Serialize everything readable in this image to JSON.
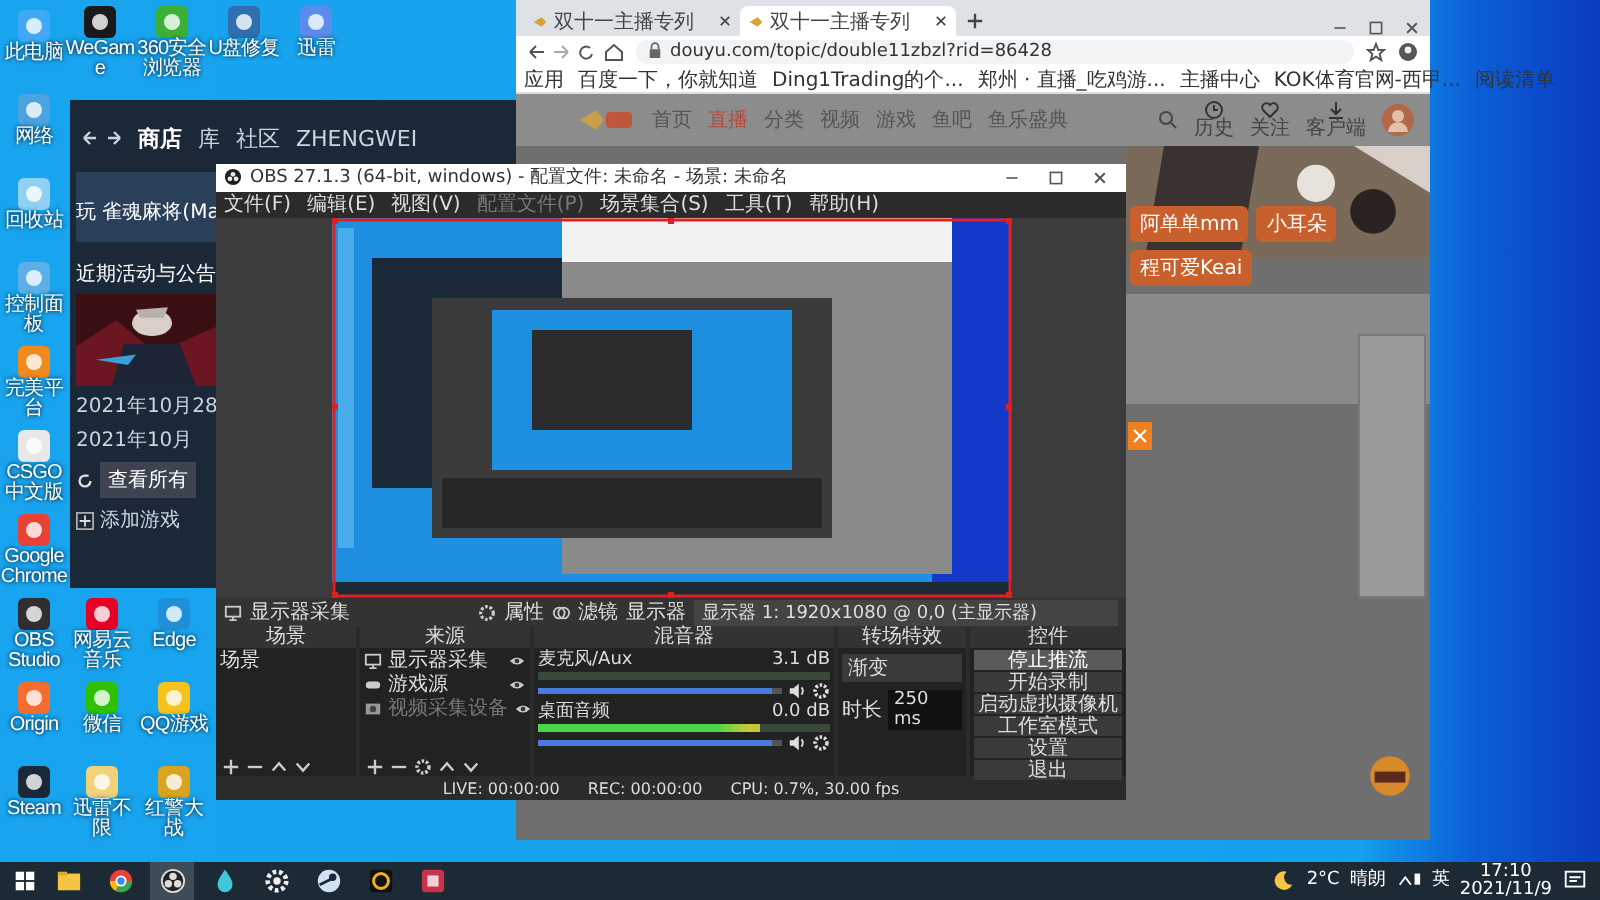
{
  "desktop": {
    "left_column": [
      {
        "label": "此电脑",
        "color": "#3fa9f5"
      },
      {
        "label": "网络",
        "color": "#4aa3df"
      },
      {
        "label": "回收站",
        "color": "#8fd0f4"
      },
      {
        "label": "控制面板",
        "color": "#5bb0e8"
      },
      {
        "label": "完美平台",
        "color": "#f08a1c"
      },
      {
        "label": "CSGO中文版",
        "color": "#e8e8e8"
      },
      {
        "label": "Google Chrome",
        "color": "#e94235"
      },
      {
        "label": "OBS Studio",
        "color": "#302e31"
      },
      {
        "label": "Origin",
        "color": "#f56c2d"
      },
      {
        "label": "Steam",
        "color": "#1b2838"
      }
    ],
    "top_row": [
      {
        "label": "WeGame",
        "color": "#1a1a1a"
      },
      {
        "label": "360安全浏览器",
        "color": "#3cb034"
      },
      {
        "label": "U盘修复",
        "color": "#2f6fb0"
      },
      {
        "label": "迅雷",
        "color": "#5a8cf0"
      }
    ],
    "grid": [
      {
        "label": "网易云音乐",
        "color": "#e60026"
      },
      {
        "label": "Edge",
        "color": "#1f8fd8"
      },
      {
        "label": "微信",
        "color": "#2dc100"
      },
      {
        "label": "QQ游戏",
        "color": "#f7c21b"
      },
      {
        "label": "迅雷不限",
        "color": "#f0d27a"
      },
      {
        "label": "红警大战",
        "color": "#d9a520"
      }
    ]
  },
  "steam": {
    "nav": [
      {
        "label": "商店",
        "selected": true
      },
      {
        "label": "库",
        "selected": false
      },
      {
        "label": "社区",
        "selected": false
      },
      {
        "label": "ZHENGWEI",
        "selected": false
      }
    ],
    "game_title": "玩 雀魂麻将(Ma",
    "section_title": "近期活动与公告",
    "event_date": "2021年10月28",
    "event_time": "2021年10月",
    "update_button": "查看所有",
    "add_game": "添加游戏"
  },
  "browser": {
    "tabs": [
      {
        "title": "双十一主播专列",
        "selected": false
      },
      {
        "title": "双十一主播专列",
        "selected": true
      }
    ],
    "url": "douyu.com/topic/double11zbzl?rid=86428",
    "bookmarks": [
      "应用",
      "百度一下，你就知道",
      "Ding1Trading的个...",
      "郑州 · 直播_吃鸡游...",
      "主播中心",
      "KOK体育官网-西甲..."
    ],
    "reading_list": "阅读清单",
    "page": {
      "nav": [
        {
          "label": "首页",
          "selected": false
        },
        {
          "label": "直播",
          "selected": true
        },
        {
          "label": "分类",
          "selected": false
        },
        {
          "label": "视频",
          "selected": false
        },
        {
          "label": "游戏",
          "selected": false
        },
        {
          "label": "鱼吧",
          "selected": false
        },
        {
          "label": "鱼乐盛典",
          "selected": false
        }
      ],
      "header_icons": [
        {
          "label": "历史",
          "kind": "clock"
        },
        {
          "label": "关注",
          "kind": "heart"
        },
        {
          "label": "客户端",
          "kind": "download"
        }
      ],
      "cards": [
        "阿单单mm",
        "小耳朵",
        "程可爱Keai"
      ]
    }
  },
  "obs": {
    "title": "OBS 27.1.3 (64-bit, windows) - 配置文件: 未命名 - 场景: 未命名",
    "menu": [
      {
        "label": "文件(F)",
        "disabled": false
      },
      {
        "label": "编辑(E)",
        "disabled": false
      },
      {
        "label": "视图(V)",
        "disabled": false
      },
      {
        "label": "配置文件(P)",
        "disabled": true
      },
      {
        "label": "场景集合(S)",
        "disabled": false
      },
      {
        "label": "工具(T)",
        "disabled": false
      },
      {
        "label": "帮助(H)",
        "disabled": false
      }
    ],
    "source_bar": {
      "source": "显示器采集",
      "properties": "属性",
      "filters": "滤镜",
      "display_label": "显示器",
      "display_value": "显示器 1: 1920x1080 @ 0,0 (主显示器)"
    },
    "docks": {
      "scenes": "场景",
      "sources": "来源",
      "mixer": "混音器",
      "transitions": "转场特效",
      "controls": "控件"
    },
    "scenes": [
      "场景"
    ],
    "sources": [
      {
        "name": "显示器采集",
        "kind": "monitor",
        "disabled": false
      },
      {
        "name": "游戏源",
        "kind": "game",
        "disabled": false
      },
      {
        "name": "视频采集设备",
        "kind": "camera",
        "disabled": true
      }
    ],
    "mixer": [
      {
        "name": "麦克风/Aux",
        "reading": "3.1 dB",
        "volume": {
          "level": 0.96
        }
      },
      {
        "name": "桌面音频",
        "reading": "0.0 dB",
        "meter": {
          "level": 0.76
        },
        "volume": {
          "level": 0.96
        }
      }
    ],
    "transition": {
      "value": "渐变",
      "duration_label": "时长",
      "duration": "250 ms"
    },
    "controls": [
      {
        "label": "停止推流",
        "selected": true
      },
      {
        "label": "开始录制",
        "selected": false
      },
      {
        "label": "启动虚拟摄像机",
        "selected": false
      },
      {
        "label": "工作室模式",
        "selected": false
      },
      {
        "label": "设置",
        "selected": false
      },
      {
        "label": "退出",
        "selected": false
      }
    ],
    "status": {
      "live": "LIVE: 00:00:00",
      "rec": "REC: 00:00:00",
      "cpu": "CPU: 0.7%, 30.00 fps"
    }
  },
  "taskbar": {
    "apps": [
      {
        "kind": "explorer",
        "selected": false
      },
      {
        "kind": "chrome",
        "selected": false
      },
      {
        "kind": "obs",
        "selected": true
      },
      {
        "kind": "drop",
        "selected": false
      },
      {
        "kind": "gear",
        "selected": false
      },
      {
        "kind": "steam",
        "selected": false
      },
      {
        "kind": "wegame",
        "selected": false
      },
      {
        "kind": "game",
        "selected": false
      }
    ],
    "weather": "2°C",
    "weather_text": "晴朗",
    "ime": "英",
    "time": "17:10",
    "date": "2021/11/9"
  }
}
